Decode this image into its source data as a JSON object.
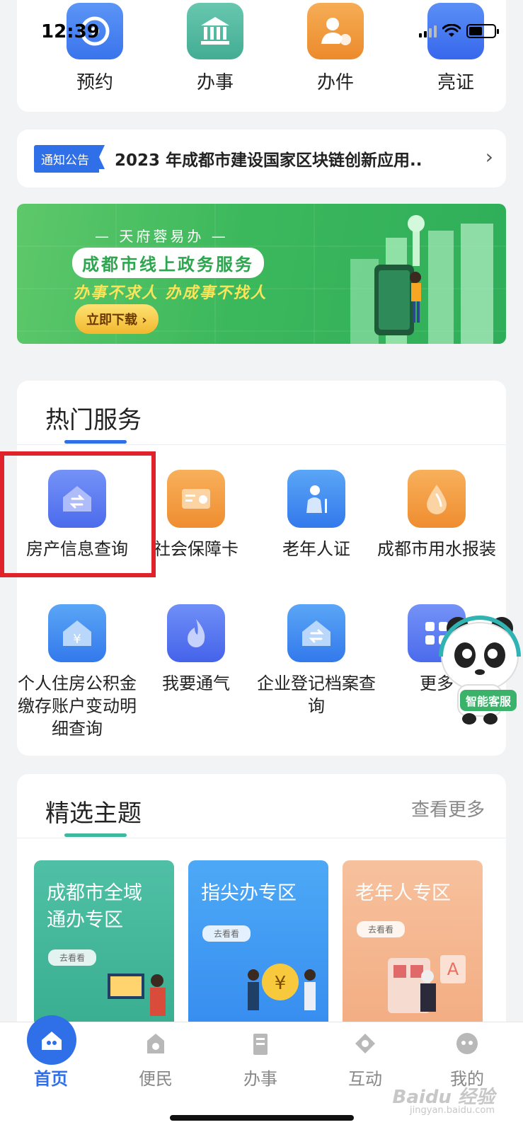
{
  "status_bar": {
    "time": "12:39"
  },
  "shortcuts": [
    {
      "label": "预约",
      "color": "#3f7ef3"
    },
    {
      "label": "办事",
      "color": "#4cb59c"
    },
    {
      "label": "办件",
      "color": "#f0983a"
    },
    {
      "label": "亮证",
      "color": "#3b72f0"
    }
  ],
  "notice": {
    "tag": "通知公告",
    "text": "2023 年成都市建设国家区块链创新应用.."
  },
  "banner": {
    "subtitle": "— 天府蓉易办 —",
    "title": "成都市线上政务服务",
    "slogan": "办事不求人 办成事不找人",
    "button": "立即下载 ›"
  },
  "hot_services": {
    "title": "热门服务",
    "accent_color": "#2f6fe8",
    "items": [
      {
        "label": "房产信息查询",
        "icon": "house-transfer-icon",
        "color": "#5877f0"
      },
      {
        "label": "社会保障卡",
        "icon": "id-card-icon",
        "color": "#f29a3f"
      },
      {
        "label": "老年人证",
        "icon": "elder-icon",
        "color": "#3f8cf0"
      },
      {
        "label": "成都市用水报装",
        "icon": "water-drop-icon",
        "color": "#f29a3f"
      },
      {
        "label": "个人住房公积金缴存账户变动明细查询",
        "icon": "house-yuan-icon",
        "color": "#3f8cf0"
      },
      {
        "label": "我要通气",
        "icon": "flame-icon",
        "color": "#5473f0"
      },
      {
        "label": "企业登记档案查询",
        "icon": "house-transfer-icon",
        "color": "#3f8cf0"
      },
      {
        "label": "更多",
        "icon": "grid-icon",
        "color": "#5877f0"
      }
    ]
  },
  "assistant": {
    "badge": "智能客服"
  },
  "featured": {
    "title": "精选主题",
    "more": "查看更多",
    "accent_color": "#3fb8a0",
    "tiles": [
      {
        "title": "成都市全域通办专区",
        "button": "去看看",
        "color": "#47b89d"
      },
      {
        "title": "指尖办专区",
        "button": "去看看",
        "color": "#3f9cf2"
      },
      {
        "title": "老年人专区",
        "button": "去看看",
        "color": "#f6b58e"
      }
    ]
  },
  "tabbar": {
    "active_color": "#2f6fe8",
    "items": [
      {
        "label": "首页",
        "icon": "home-icon"
      },
      {
        "label": "便民",
        "icon": "convenience-icon"
      },
      {
        "label": "办事",
        "icon": "office-icon"
      },
      {
        "label": "互动",
        "icon": "interaction-icon"
      },
      {
        "label": "我的",
        "icon": "profile-icon"
      }
    ]
  },
  "watermark": {
    "brand": "Baidu 经验",
    "url": "jingyan.baidu.com"
  }
}
